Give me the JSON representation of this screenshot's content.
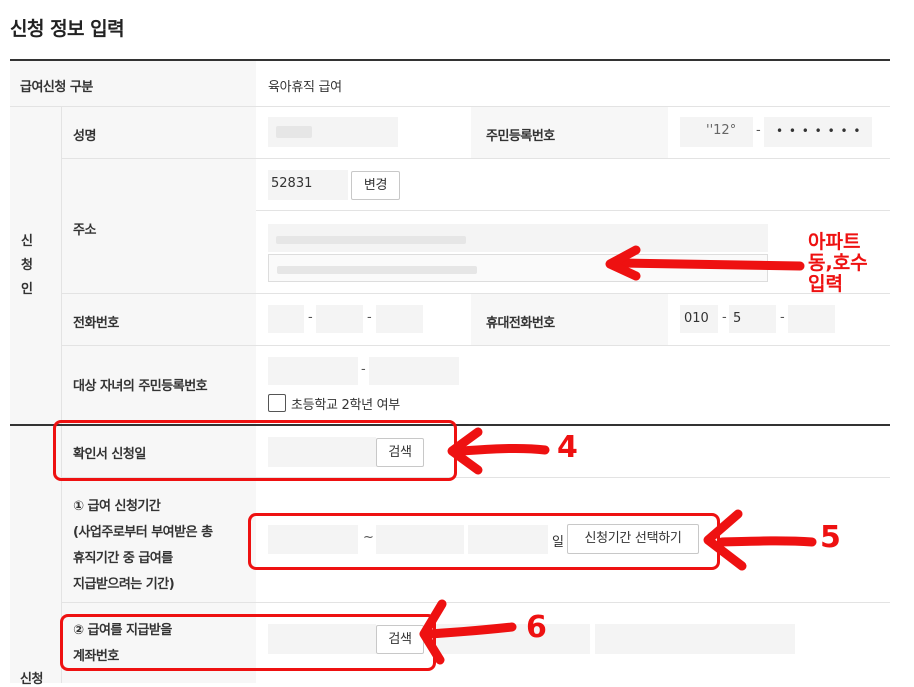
{
  "page": {
    "title": "신청 정보 입력"
  },
  "rows": {
    "benefit_type": {
      "label": "급여신청 구분",
      "value": "육아휴직 급여"
    },
    "applicant_group": {
      "label_chars": [
        "신",
        "청",
        "인"
      ]
    },
    "name": {
      "label": "성명"
    },
    "resident_no": {
      "label": "주민등록번호",
      "front_partial": "''12°",
      "back_masked": "• • • • • • •"
    },
    "address": {
      "label": "주소",
      "postcode": "52831",
      "change_button": "변경"
    },
    "phone": {
      "label": "전화번호"
    },
    "mobile": {
      "label": "휴대전화번호",
      "prefix": "010",
      "middle": "5"
    },
    "child_resident_no": {
      "label": "대상 자녀의 주민등록번호",
      "checkbox_label": "초등학교 2학년 여부"
    },
    "confirm_date": {
      "label": "확인서 신청일",
      "search_button": "검색"
    },
    "period": {
      "label_lines": [
        "① 급여 신청기간",
        "(사업주로부터 부여받은 총",
        "휴직기간 중 급여를",
        "지급받으려는 기간)"
      ],
      "tilde": "~",
      "day_suffix": "일",
      "select_button": "신청기간 선택하기"
    },
    "account": {
      "label_lines": [
        "② 급여를 지급받을",
        "계좌번호"
      ],
      "search_button": "검색"
    },
    "next_group": {
      "label": "신청"
    }
  },
  "annotations": {
    "address_note": [
      "아파트",
      "동,호수",
      "입력"
    ],
    "step4": "4",
    "step5": "5",
    "step6": "6",
    "color": "#ee1111"
  },
  "colors": {
    "label_bg": "#f7f7f7",
    "field_bg": "#f4f4f4",
    "rule": "#333333",
    "line": "#e3e3e3"
  }
}
